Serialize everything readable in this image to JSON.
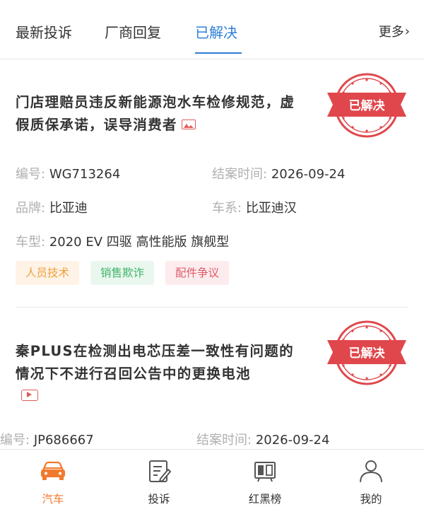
{
  "tabs": {
    "items": [
      {
        "label": "最新投诉"
      },
      {
        "label": "厂商回复"
      },
      {
        "label": "已解决"
      }
    ],
    "more_label": "更多",
    "more_chevron": "›",
    "active_color": "#2f7fd8"
  },
  "complaints": [
    {
      "title": "门店理赔员违反新能源泡水车检修规范，虚假质保承诺，误导消费者",
      "media_icon": "image-icon",
      "stamp": "已解决",
      "id_key": "编号:",
      "id_value": "WG713264",
      "closed_key": "结案时间:",
      "closed_value": "2026-09-24",
      "brand_key": "品牌:",
      "brand_value": "比亚迪",
      "series_key": "车系:",
      "series_value": "比亚迪汉",
      "model_key": "车型:",
      "model_value": "2020 EV 四驱 高性能版 旗舰型",
      "tags": [
        "人员技术",
        "销售欺诈",
        "配件争议"
      ]
    },
    {
      "title": "秦PLUS在检测出电芯压差一致性有问题的情况下不进行召回公告中的更换电池",
      "media_icon": "video-icon",
      "stamp": "已解决",
      "id_key": "编号:",
      "id_value": "JP686667",
      "closed_key": "结案时间:",
      "closed_value": "2026-09-24"
    }
  ],
  "bottom_nav": [
    {
      "label": "汽车",
      "icon": "car-icon",
      "active": true
    },
    {
      "label": "投诉",
      "icon": "complaint-icon",
      "active": false
    },
    {
      "label": "红黑榜",
      "icon": "ranking-icon",
      "active": false
    },
    {
      "label": "我的",
      "icon": "user-icon",
      "active": false
    }
  ],
  "colors": {
    "stamp_red": "#e0474c",
    "accent_orange": "#f07a2e"
  }
}
